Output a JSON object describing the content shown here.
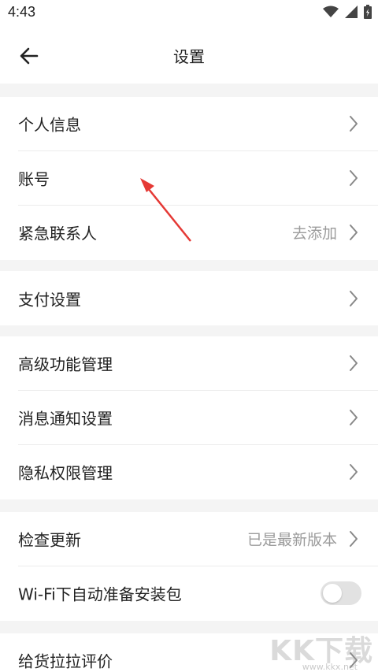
{
  "status_bar": {
    "time": "4:43"
  },
  "header": {
    "title": "设置"
  },
  "groups": [
    {
      "items": [
        {
          "label": "个人信息"
        },
        {
          "label": "账号"
        },
        {
          "label": "紧急联系人",
          "value": "去添加"
        }
      ]
    },
    {
      "items": [
        {
          "label": "支付设置"
        }
      ]
    },
    {
      "items": [
        {
          "label": "高级功能管理"
        },
        {
          "label": "消息通知设置"
        },
        {
          "label": "隐私权限管理"
        }
      ]
    },
    {
      "items": [
        {
          "label": "检查更新",
          "value": "已是最新版本"
        },
        {
          "label": "Wi-Fi下自动准备安装包",
          "toggle": false
        }
      ]
    },
    {
      "items": [
        {
          "label": "给货拉拉评价"
        }
      ]
    }
  ],
  "annotation": {
    "color": "#e53935"
  },
  "watermark": {
    "text": "KK下载",
    "url": "www.kkx.net"
  },
  "colors": {
    "accent_arrow": "#e53935",
    "secondary_text": "#9b9b9b",
    "background": "#f4f4f4"
  }
}
